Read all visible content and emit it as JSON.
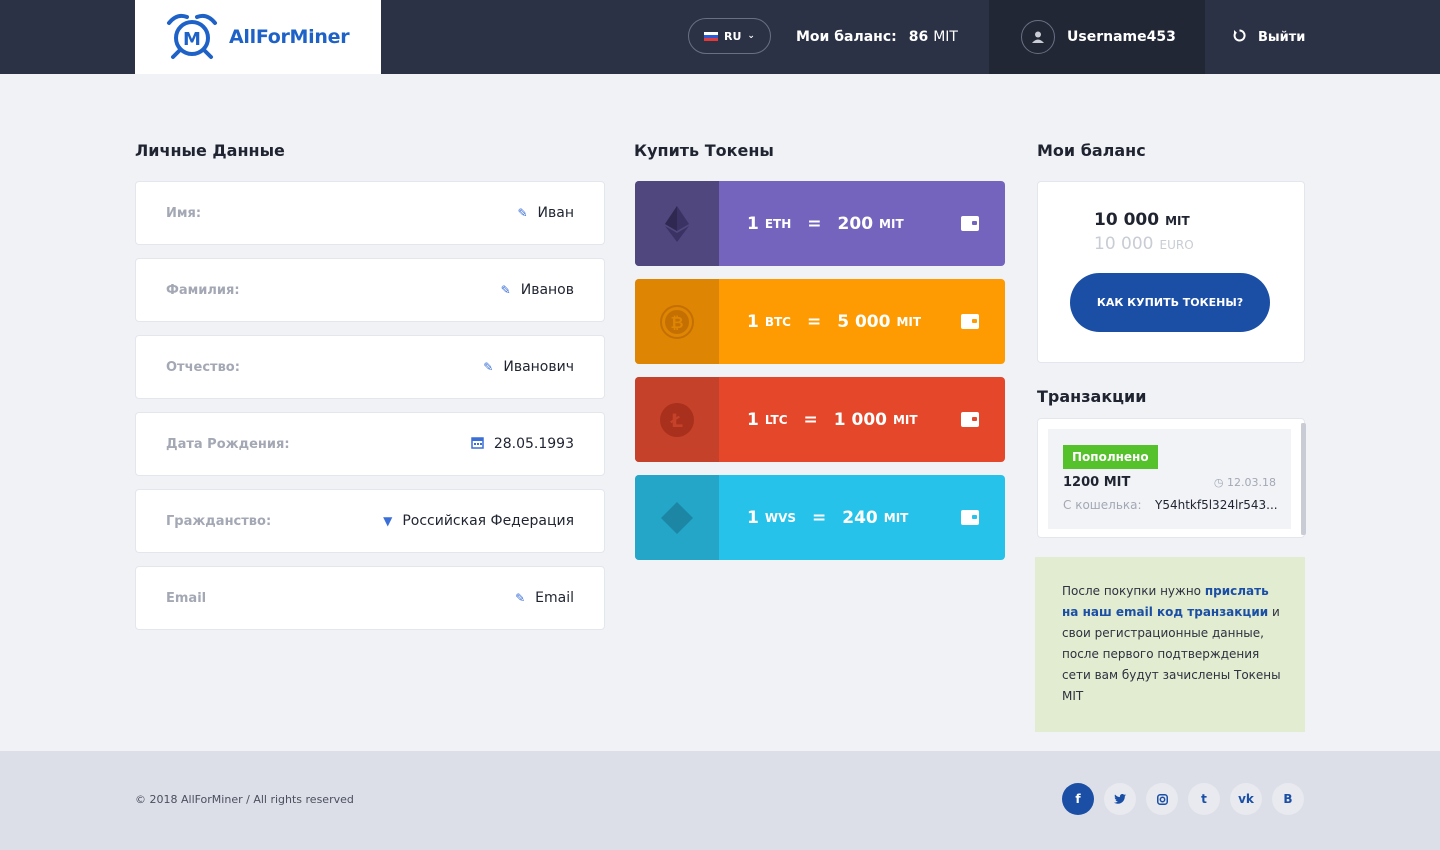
{
  "header": {
    "brand": "AllForMiner",
    "logo_letter": "M",
    "language": "RU",
    "balance_label": "Мои баланс:",
    "balance_value": "86",
    "balance_unit": "MIT",
    "username": "Username453",
    "logout_label": "Выйти"
  },
  "personal": {
    "title": "Личные Данные",
    "fields": [
      {
        "label": "Имя:",
        "value": "Иван",
        "icon": "pencil-icon"
      },
      {
        "label": "Фамилия:",
        "value": "Иванов",
        "icon": "pencil-icon"
      },
      {
        "label": "Отчество:",
        "value": "Иванович",
        "icon": "pencil-icon"
      },
      {
        "label": "Дата Рождения:",
        "value": "28.05.1993",
        "icon": "calendar-icon"
      },
      {
        "label": "Гражданство:",
        "value": "Российская Федерация",
        "icon": "dropdown-arrow-icon"
      },
      {
        "label": "Email",
        "value": "Email",
        "icon": "pencil-icon"
      }
    ]
  },
  "tokens": {
    "title": "Купить Токены",
    "items": [
      {
        "amount": "1",
        "coin": "ETH",
        "eq": "=",
        "price": "200",
        "unit": "MIT",
        "icon": "ethereum-icon",
        "color": "#7464bd",
        "dark": "#51477f"
      },
      {
        "amount": "1",
        "coin": "BTC",
        "eq": "=",
        "price": "5 000",
        "unit": "MIT",
        "icon": "bitcoin-icon",
        "color": "#fe9b03",
        "dark": "#de8504"
      },
      {
        "amount": "1",
        "coin": "LTC",
        "eq": "=",
        "price": "1 000",
        "unit": "MIT",
        "icon": "litecoin-icon",
        "color": "#e4472a",
        "dark": "#c54129"
      },
      {
        "amount": "1",
        "coin": "WVS",
        "eq": "=",
        "price": "240",
        "unit": "MIT",
        "icon": "waves-icon",
        "color": "#26c2ea",
        "dark": "#24a6c9"
      }
    ]
  },
  "balance": {
    "title": "Мои баланс",
    "mit_value": "10 000",
    "mit_unit": "MIT",
    "euro_value": "10 000",
    "euro_unit": "EURO",
    "button_label": "КАК КУПИТЬ ТОКЕНЫ?"
  },
  "transactions": {
    "title": "Транзакции",
    "items": [
      {
        "status": "Пополнено",
        "amount": "1200 MIT",
        "date": "12.03.18",
        "from_label": "С кошелька:",
        "from_address": "Y54htkf5l324lr543..."
      }
    ]
  },
  "note": {
    "text_before": "После покупки нужно ",
    "highlight": "прислать на наш email код транзакции",
    "text_after": " и свои регистрационные данные, после первого подтверждения сети вам будут зачислены Токены MIT"
  },
  "footer": {
    "copyright": "© 2018 AllForMiner / All rights reserved",
    "socials": [
      {
        "name": "facebook-icon",
        "glyph": "f"
      },
      {
        "name": "twitter-icon",
        "glyph": "t"
      },
      {
        "name": "instagram-icon",
        "glyph": "◎"
      },
      {
        "name": "tumblr-icon",
        "glyph": "t"
      },
      {
        "name": "vk-icon",
        "glyph": "vk"
      },
      {
        "name": "behance-icon",
        "glyph": "B"
      }
    ]
  }
}
